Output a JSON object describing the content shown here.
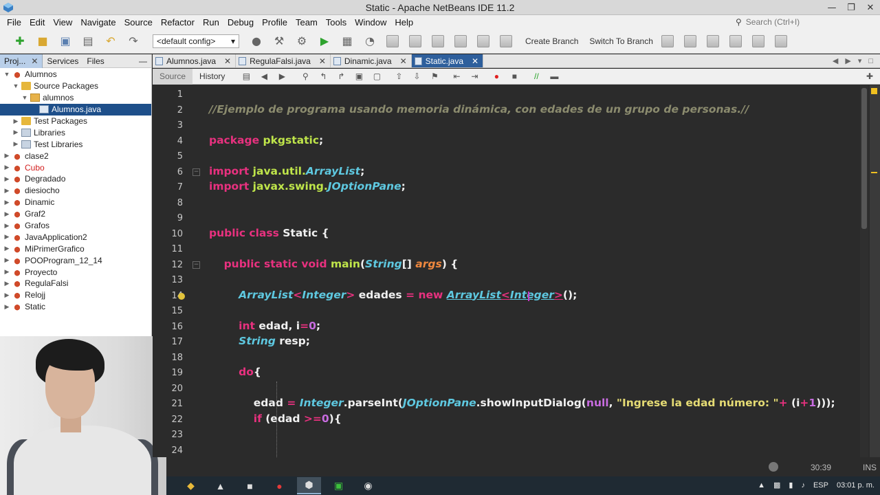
{
  "window": {
    "title": "Static - Apache NetBeans IDE 11.2"
  },
  "menu": {
    "items": [
      "File",
      "Edit",
      "View",
      "Navigate",
      "Source",
      "Refactor",
      "Run",
      "Debug",
      "Profile",
      "Team",
      "Tools",
      "Window",
      "Help"
    ],
    "search_placeholder": "Search (Ctrl+I)"
  },
  "toolbar": {
    "config": "<default config>",
    "create_branch": "Create Branch",
    "switch_branch": "Switch To Branch"
  },
  "left_panel": {
    "tabs": [
      "Proj...",
      "Services",
      "Files"
    ],
    "tree": [
      {
        "label": "Alumnos",
        "depth": 0,
        "icon": "coffee-icon",
        "toggle": "expanded"
      },
      {
        "label": "Source Packages",
        "depth": 1,
        "icon": "folder-icon",
        "toggle": "expanded"
      },
      {
        "label": "alumnos",
        "depth": 2,
        "icon": "package-icon",
        "toggle": "expanded"
      },
      {
        "label": "Alumnos.java",
        "depth": 3,
        "icon": "java-file-icon",
        "toggle": "none",
        "selected": true
      },
      {
        "label": "Test Packages",
        "depth": 1,
        "icon": "folder-icon",
        "toggle": "collapsed"
      },
      {
        "label": "Libraries",
        "depth": 1,
        "icon": "library-icon",
        "toggle": "collapsed"
      },
      {
        "label": "Test Libraries",
        "depth": 1,
        "icon": "library-icon",
        "toggle": "collapsed"
      },
      {
        "label": "clase2",
        "depth": 0,
        "icon": "coffee-icon",
        "toggle": "collapsed"
      },
      {
        "label": "Cubo",
        "depth": 0,
        "icon": "coffee-icon",
        "toggle": "collapsed",
        "error": true
      },
      {
        "label": "Degradado",
        "depth": 0,
        "icon": "coffee-icon",
        "toggle": "collapsed"
      },
      {
        "label": "diesiocho",
        "depth": 0,
        "icon": "coffee-icon",
        "toggle": "collapsed"
      },
      {
        "label": "Dinamic",
        "depth": 0,
        "icon": "coffee-icon",
        "toggle": "collapsed"
      },
      {
        "label": "Graf2",
        "depth": 0,
        "icon": "coffee-icon",
        "toggle": "collapsed"
      },
      {
        "label": "Grafos",
        "depth": 0,
        "icon": "coffee-icon",
        "toggle": "collapsed"
      },
      {
        "label": "JavaApplication2",
        "depth": 0,
        "icon": "coffee-icon",
        "toggle": "collapsed"
      },
      {
        "label": "MiPrimerGrafico",
        "depth": 0,
        "icon": "coffee-icon",
        "toggle": "collapsed"
      },
      {
        "label": "POOProgram_12_14",
        "depth": 0,
        "icon": "coffee-icon",
        "toggle": "collapsed"
      },
      {
        "label": "Proyecto",
        "depth": 0,
        "icon": "coffee-icon",
        "toggle": "collapsed"
      },
      {
        "label": "RegulaFalsi",
        "depth": 0,
        "icon": "coffee-icon",
        "toggle": "collapsed"
      },
      {
        "label": "Relojj",
        "depth": 0,
        "icon": "coffee-icon",
        "toggle": "collapsed"
      },
      {
        "label": "Static",
        "depth": 0,
        "icon": "coffee-icon",
        "toggle": "collapsed"
      }
    ]
  },
  "editor": {
    "tabs": [
      {
        "label": "Alumnos.java",
        "active": false
      },
      {
        "label": "RegulaFalsi.java",
        "active": false
      },
      {
        "label": "Dinamic.java",
        "active": false
      },
      {
        "label": "Static.java",
        "active": true
      }
    ],
    "subtabs": [
      "Source",
      "History"
    ],
    "lines": [
      {
        "n": "1",
        "tokens": []
      },
      {
        "n": "2",
        "tokens": [
          {
            "t": "//Ejemplo de programa usando memoria dinámica, con edades de un grupo de personas.//",
            "c": "cm"
          }
        ]
      },
      {
        "n": "3",
        "tokens": []
      },
      {
        "n": "4",
        "tokens": [
          {
            "t": "package ",
            "c": "kw"
          },
          {
            "t": "pkgstatic",
            "c": "pk"
          },
          {
            "t": ";",
            "c": "id"
          }
        ]
      },
      {
        "n": "5",
        "tokens": []
      },
      {
        "n": "6",
        "tokens": [
          {
            "t": "import ",
            "c": "kw"
          },
          {
            "t": "java.util.",
            "c": "pk"
          },
          {
            "t": "ArrayList",
            "c": "ty"
          },
          {
            "t": ";",
            "c": "id"
          }
        ],
        "fold": true
      },
      {
        "n": "7",
        "tokens": [
          {
            "t": "import ",
            "c": "kw"
          },
          {
            "t": "javax.swing.",
            "c": "pk"
          },
          {
            "t": "JOptionPane",
            "c": "ty"
          },
          {
            "t": ";",
            "c": "id"
          }
        ]
      },
      {
        "n": "8",
        "tokens": []
      },
      {
        "n": "9",
        "tokens": []
      },
      {
        "n": "10",
        "tokens": [
          {
            "t": "public class ",
            "c": "kw"
          },
          {
            "t": "Static {",
            "c": "id"
          }
        ]
      },
      {
        "n": "11",
        "tokens": []
      },
      {
        "n": "12",
        "tokens": [
          {
            "t": "    public static void ",
            "c": "kw"
          },
          {
            "t": "main",
            "c": "fn"
          },
          {
            "t": "(",
            "c": "id"
          },
          {
            "t": "String",
            "c": "ty"
          },
          {
            "t": "[] ",
            "c": "id"
          },
          {
            "t": "args",
            "c": "par"
          },
          {
            "t": ") {",
            "c": "id"
          }
        ],
        "fold": true
      },
      {
        "n": "13",
        "tokens": []
      },
      {
        "n": "14",
        "tokens": [
          {
            "t": "        ",
            "c": "id"
          },
          {
            "t": "ArrayList",
            "c": "ty"
          },
          {
            "t": "<",
            "c": "gt"
          },
          {
            "t": "Integer",
            "c": "ty"
          },
          {
            "t": ">",
            "c": "gt"
          },
          {
            "t": " edades ",
            "c": "id"
          },
          {
            "t": "= ",
            "c": "kw"
          },
          {
            "t": "new ",
            "c": "kw"
          },
          {
            "t": "ArrayList",
            "c": "ty ul"
          },
          {
            "t": "<",
            "c": "gt ul"
          },
          {
            "t": "Integer",
            "c": "ty ul"
          },
          {
            "t": ">",
            "c": "gt ul"
          },
          {
            "t": "();",
            "c": "id"
          }
        ],
        "bulb": true
      },
      {
        "n": "15",
        "tokens": []
      },
      {
        "n": "16",
        "tokens": [
          {
            "t": "        ",
            "c": "id"
          },
          {
            "t": "int ",
            "c": "kw"
          },
          {
            "t": "edad, ",
            "c": "id"
          },
          {
            "t": "i",
            "c": "id"
          },
          {
            "t": "=",
            "c": "kw"
          },
          {
            "t": "0",
            "c": "num"
          },
          {
            "t": ";",
            "c": "id"
          }
        ]
      },
      {
        "n": "17",
        "tokens": [
          {
            "t": "        ",
            "c": "id"
          },
          {
            "t": "String ",
            "c": "ty"
          },
          {
            "t": "resp;",
            "c": "id"
          }
        ]
      },
      {
        "n": "18",
        "tokens": []
      },
      {
        "n": "19",
        "tokens": [
          {
            "t": "        ",
            "c": "id"
          },
          {
            "t": "do",
            "c": "kw"
          },
          {
            "t": "{",
            "c": "id"
          }
        ]
      },
      {
        "n": "20",
        "tokens": []
      },
      {
        "n": "21",
        "tokens": [
          {
            "t": "            edad ",
            "c": "id"
          },
          {
            "t": "= ",
            "c": "kw"
          },
          {
            "t": "Integer",
            "c": "ty"
          },
          {
            "t": ".parseInt(",
            "c": "id"
          },
          {
            "t": "JOptionPane",
            "c": "ty"
          },
          {
            "t": ".showInputDialog(",
            "c": "id"
          },
          {
            "t": "null",
            "c": "num"
          },
          {
            "t": ", ",
            "c": "id"
          },
          {
            "t": "\"Ingrese la edad número: \"",
            "c": "str"
          },
          {
            "t": "+ ",
            "c": "kw"
          },
          {
            "t": "(i",
            "c": "id"
          },
          {
            "t": "+",
            "c": "kw"
          },
          {
            "t": "1",
            "c": "num"
          },
          {
            "t": ")));",
            "c": "id"
          }
        ]
      },
      {
        "n": "22",
        "tokens": [
          {
            "t": "            ",
            "c": "id"
          },
          {
            "t": "if ",
            "c": "kw"
          },
          {
            "t": "(edad ",
            "c": "id"
          },
          {
            "t": ">=",
            "c": "kw"
          },
          {
            "t": "0",
            "c": "num"
          },
          {
            "t": "){",
            "c": "id"
          }
        ]
      },
      {
        "n": "23",
        "tokens": []
      },
      {
        "n": "24",
        "tokens": []
      }
    ]
  },
  "status": {
    "position": "30:39",
    "mode": "INS"
  },
  "taskbar": {
    "lang": "ESP",
    "time": "03:01 p. m."
  }
}
